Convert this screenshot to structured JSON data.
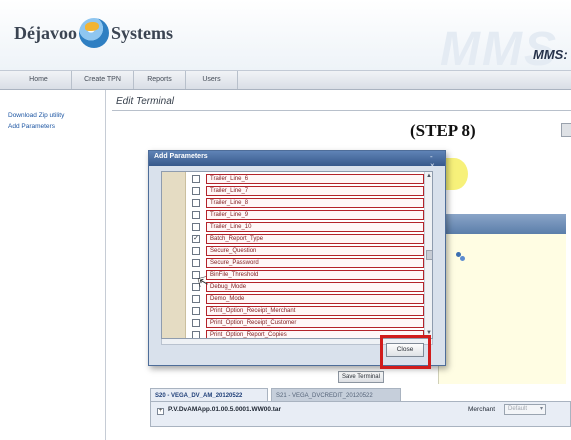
{
  "header": {
    "brand_left": "Déjavoo",
    "brand_right": "Systems",
    "watermark": "MMS",
    "app_label": "MMS:"
  },
  "nav": {
    "items": [
      {
        "label": "Home"
      },
      {
        "label": "Create TPN"
      },
      {
        "label": "Reports"
      },
      {
        "label": "Users"
      }
    ]
  },
  "sidebar": {
    "links": [
      {
        "label": "Download Zip utility"
      },
      {
        "label": "Add Parameters"
      }
    ]
  },
  "main": {
    "title": "Edit Terminal",
    "step_label": "(STEP 8)",
    "save_terminal_label": "Save Terminal",
    "tabs": [
      {
        "label": "S20 - VEGA_DV_AM_20120522",
        "active": true
      },
      {
        "label": "S21 - VEGA_DVCREDIT_20120522",
        "active": false
      }
    ],
    "file_expander": "+",
    "file_name": "P.V.DvAMApp.01.00.5.0001.WW00.tar",
    "merchant_label": "Merchant",
    "merchant_value": "Default"
  },
  "dialog": {
    "title": "Add Parameters",
    "controls": "- ×",
    "close_label": "Close",
    "scroll_up": "▲",
    "scroll_down": "▼",
    "cursor": "⇱",
    "params": [
      {
        "name": "Trailer_Line_6",
        "checked": false
      },
      {
        "name": "Trailer_Line_7",
        "checked": false
      },
      {
        "name": "Trailer_Line_8",
        "checked": false
      },
      {
        "name": "Trailer_Line_9",
        "checked": false
      },
      {
        "name": "Trailer_Line_10",
        "checked": false
      },
      {
        "name": "Batch_Report_Type",
        "checked": true
      },
      {
        "name": "Secure_Question",
        "checked": false
      },
      {
        "name": "Secure_Password",
        "checked": false
      },
      {
        "name": "BinFile_Threshold",
        "checked": false
      },
      {
        "name": "Debug_Mode",
        "checked": false
      },
      {
        "name": "Demo_Mode",
        "checked": false
      },
      {
        "name": "Print_Option_Receipt_Merchant",
        "checked": false
      },
      {
        "name": "Print_Option_Receipt_Customer",
        "checked": false
      },
      {
        "name": "Print_Option_Report_Copies",
        "checked": false
      }
    ]
  },
  "colors": {
    "highlight": "#d11c1c",
    "field_border": "#b4232a",
    "dialog_title_bg": "#37598b"
  }
}
